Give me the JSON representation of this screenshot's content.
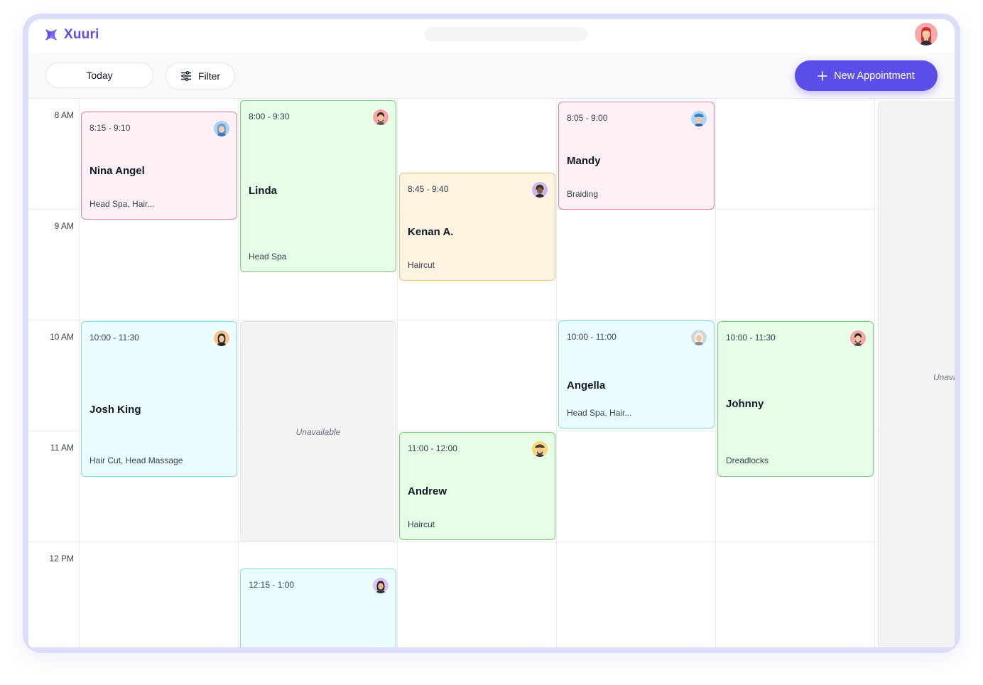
{
  "app": {
    "name": "Xuuri"
  },
  "toolbar": {
    "today_label": "Today",
    "filter_label": "Filter",
    "new_label": "New Appointment"
  },
  "timeline": {
    "hours": [
      "8 AM",
      "9 AM",
      "10 AM",
      "11 AM",
      "12 PM"
    ]
  },
  "unavailable_label": "Unavailable",
  "unavailable_partial_label": "Unavai",
  "appointments": [
    {
      "time": "8:15 - 9:10",
      "name": "Nina Angel",
      "service": "Head Spa, Hair..."
    },
    {
      "time": "8:00 - 9:30",
      "name": "Linda",
      "service": "Head Spa"
    },
    {
      "time": "8:45 - 9:40",
      "name": "Kenan A.",
      "service": "Haircut"
    },
    {
      "time": "8:05 - 9:00",
      "name": "Mandy",
      "service": "Braiding"
    },
    {
      "time": "10:00 - 11:30",
      "name": "Josh King",
      "service": "Hair Cut, Head Massage"
    },
    {
      "time": "10:00 - 11:00",
      "name": "Angella",
      "service": "Head Spa, Hair..."
    },
    {
      "time": "10:00 - 11:30",
      "name": "Johnny",
      "service": "Dreadlocks"
    },
    {
      "time": "11:00 - 12:00",
      "name": "Andrew",
      "service": "Haircut"
    },
    {
      "time": "12:15 - 1:00"
    }
  ],
  "colors": {
    "accent": "#5b4ee8",
    "pink": "#e879b0",
    "green": "#78d178",
    "orange": "#f4c17d",
    "cyan": "#7fdbe9"
  },
  "icons": {
    "logo": "xuuri-logo-icon",
    "filter": "sliders-icon",
    "add": "plus-icon",
    "avatar": "avatar-icon"
  }
}
